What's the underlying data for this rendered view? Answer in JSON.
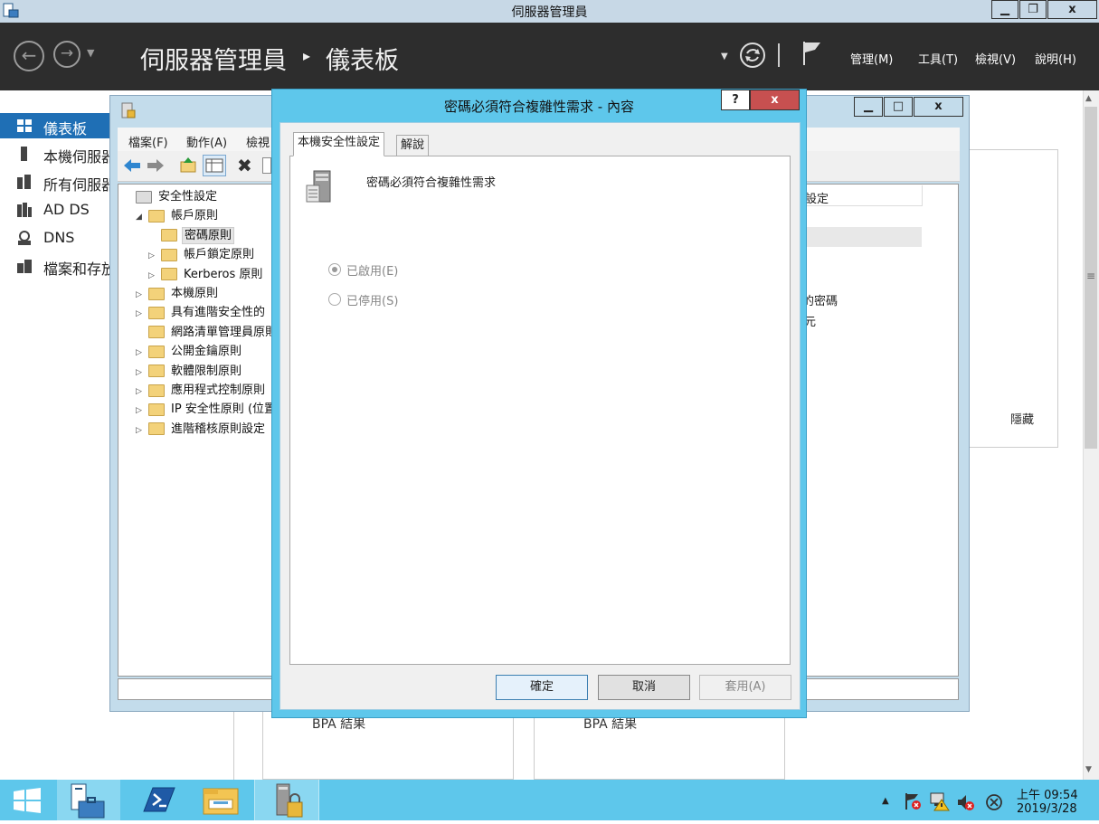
{
  "server_manager": {
    "window_title": "伺服器管理員",
    "caption_buttons": {
      "minimize": "▁",
      "restore": "❐",
      "close": "x"
    },
    "breadcrumb": {
      "root": "伺服器管理員",
      "separator": "▸",
      "current": "儀表板"
    },
    "menu": [
      "管理(M)",
      "工具(T)",
      "檢視(V)",
      "說明(H)"
    ],
    "nav": [
      {
        "label": "儀表板",
        "active": true
      },
      {
        "label": "本機伺服器"
      },
      {
        "label": "所有伺服器"
      },
      {
        "label": "AD DS"
      },
      {
        "label": "DNS"
      },
      {
        "label": "檔案和存放服務"
      }
    ],
    "right_fragments": {
      "col_header": "設定",
      "line1": "的密碼",
      "line2": "元",
      "hide": "隱藏"
    },
    "bpa": [
      "BPA 結果",
      "BPA 結果"
    ]
  },
  "mmc": {
    "menu": [
      "檔案(F)",
      "動作(A)",
      "檢視"
    ],
    "caption_buttons": {
      "minimize": "▁",
      "restore": "□",
      "close": "x"
    },
    "tree": [
      {
        "label": "安全性設定",
        "indent": 0,
        "expander": ""
      },
      {
        "label": "帳戶原則",
        "indent": 1,
        "expander": "◢"
      },
      {
        "label": "密碼原則",
        "indent": 2,
        "expander": "",
        "selected": true
      },
      {
        "label": "帳戶鎖定原則",
        "indent": 2,
        "expander": "▷"
      },
      {
        "label": "Kerberos 原則",
        "indent": 2,
        "expander": "▷"
      },
      {
        "label": "本機原則",
        "indent": 1,
        "expander": "▷"
      },
      {
        "label": "具有進階安全性的",
        "indent": 1,
        "expander": "▷"
      },
      {
        "label": "網路清單管理員原則",
        "indent": 1,
        "expander": ""
      },
      {
        "label": "公開金鑰原則",
        "indent": 1,
        "expander": "▷"
      },
      {
        "label": "軟體限制原則",
        "indent": 1,
        "expander": "▷"
      },
      {
        "label": "應用程式控制原則",
        "indent": 1,
        "expander": "▷"
      },
      {
        "label": "IP 安全性原則 (位置",
        "indent": 1,
        "expander": "▷"
      },
      {
        "label": "進階稽核原則設定",
        "indent": 1,
        "expander": "▷"
      }
    ]
  },
  "dialog": {
    "title": "密碼必須符合複雜性需求 - 內容",
    "help_btn": "?",
    "close_btn": "x",
    "tabs": [
      "本機安全性設定",
      "解說"
    ],
    "policy_name": "密碼必須符合複雜性需求",
    "options": [
      {
        "label": "已啟用(E)",
        "checked": true
      },
      {
        "label": "已停用(S)",
        "checked": false
      }
    ],
    "buttons": {
      "ok": "確定",
      "cancel": "取消",
      "apply": "套用(A)"
    }
  },
  "taskbar": {
    "clock_time": "上午 09:54",
    "clock_date": "2019/3/28",
    "tray_arrow": "▲"
  },
  "colors": {
    "accent": "#1f6fb5",
    "header": "#2d2d2d",
    "taskbar": "#5ec7eb",
    "close_red": "#c75050"
  }
}
